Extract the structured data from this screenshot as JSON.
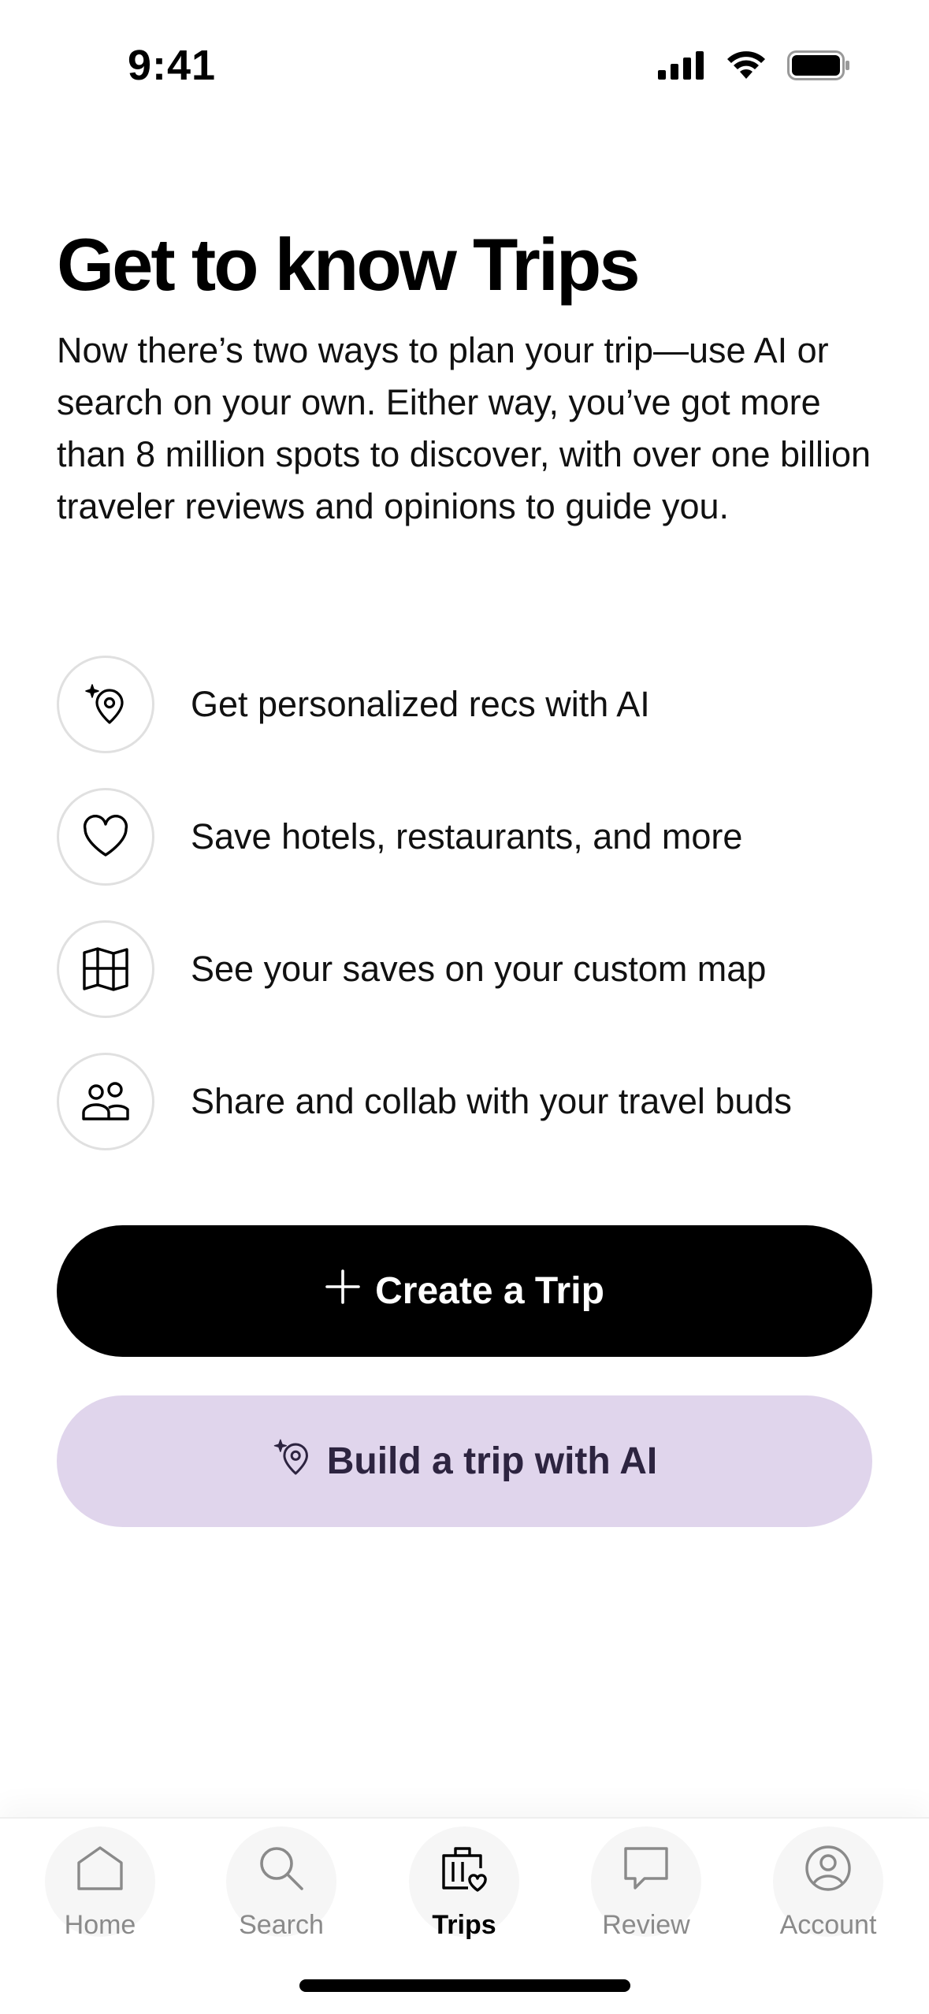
{
  "status_bar": {
    "time": "9:41",
    "icons": [
      "cellular-signal-icon",
      "wifi-icon",
      "battery-icon"
    ]
  },
  "header": {
    "title": "Get to know Trips"
  },
  "intro": {
    "text": "Now there’s two ways to plan your trip—use AI or search on your own. Either way, you’ve got more than 8 million spots to discover, with over one billion traveler reviews and opinions to guide you."
  },
  "features": [
    {
      "icon": "sparkle-location-pin-icon",
      "label": "Get personalized recs with AI"
    },
    {
      "icon": "heart-icon",
      "label": "Save hotels, restaurants, and more"
    },
    {
      "icon": "map-icon",
      "label": "See your saves on your custom map"
    },
    {
      "icon": "people-icon",
      "label": "Share and collab with your travel buds"
    }
  ],
  "actions": {
    "create_trip": {
      "icon": "plus-icon",
      "label": "Create a Trip"
    },
    "build_ai": {
      "icon": "sparkle-location-pin-icon",
      "label": "Build a trip with AI"
    }
  },
  "tab_bar": {
    "items": [
      {
        "icon": "home-icon",
        "label": "Home"
      },
      {
        "icon": "search-icon",
        "label": "Search"
      },
      {
        "icon": "suitcase-heart-icon",
        "label": "Trips",
        "active": true
      },
      {
        "icon": "review-bubble-icon",
        "label": "Review"
      },
      {
        "icon": "account-icon",
        "label": "Account"
      }
    ]
  },
  "colors": {
    "primary_button": "#000000",
    "ai_button": "#e0d5ec",
    "ai_button_text": "#2d2440",
    "inactive_tab": "#8a8a8a"
  }
}
